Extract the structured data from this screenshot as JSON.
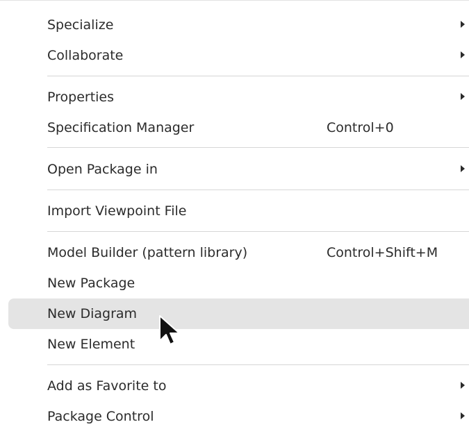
{
  "menu": {
    "items": [
      {
        "label": "Specialize",
        "shortcut": "",
        "submenu": true
      },
      {
        "label": "Collaborate",
        "shortcut": "",
        "submenu": true
      },
      {
        "label": "Properties",
        "shortcut": "",
        "submenu": true
      },
      {
        "label": "Specification Manager",
        "shortcut": "Control+0",
        "submenu": false
      },
      {
        "label": "Open Package in",
        "shortcut": "",
        "submenu": true
      },
      {
        "label": "Import Viewpoint File",
        "shortcut": "",
        "submenu": false
      },
      {
        "label": "Model Builder (pattern library)",
        "shortcut": "Control+Shift+M",
        "submenu": false
      },
      {
        "label": "New Package",
        "shortcut": "",
        "submenu": false
      },
      {
        "label": "New Diagram",
        "shortcut": "",
        "submenu": false,
        "highlighted": true
      },
      {
        "label": "New Element",
        "shortcut": "",
        "submenu": false
      },
      {
        "label": "Add as Favorite to",
        "shortcut": "",
        "submenu": true
      },
      {
        "label": "Package Control",
        "shortcut": "",
        "submenu": true
      }
    ]
  },
  "colors": {
    "text": "#2b2b2b",
    "highlight": "#e4e4e4",
    "separator": "#d6d6d6",
    "background": "#ffffff"
  },
  "icons": {
    "submenu": "chevron-right-icon",
    "cursor": "mouse-pointer-icon"
  }
}
